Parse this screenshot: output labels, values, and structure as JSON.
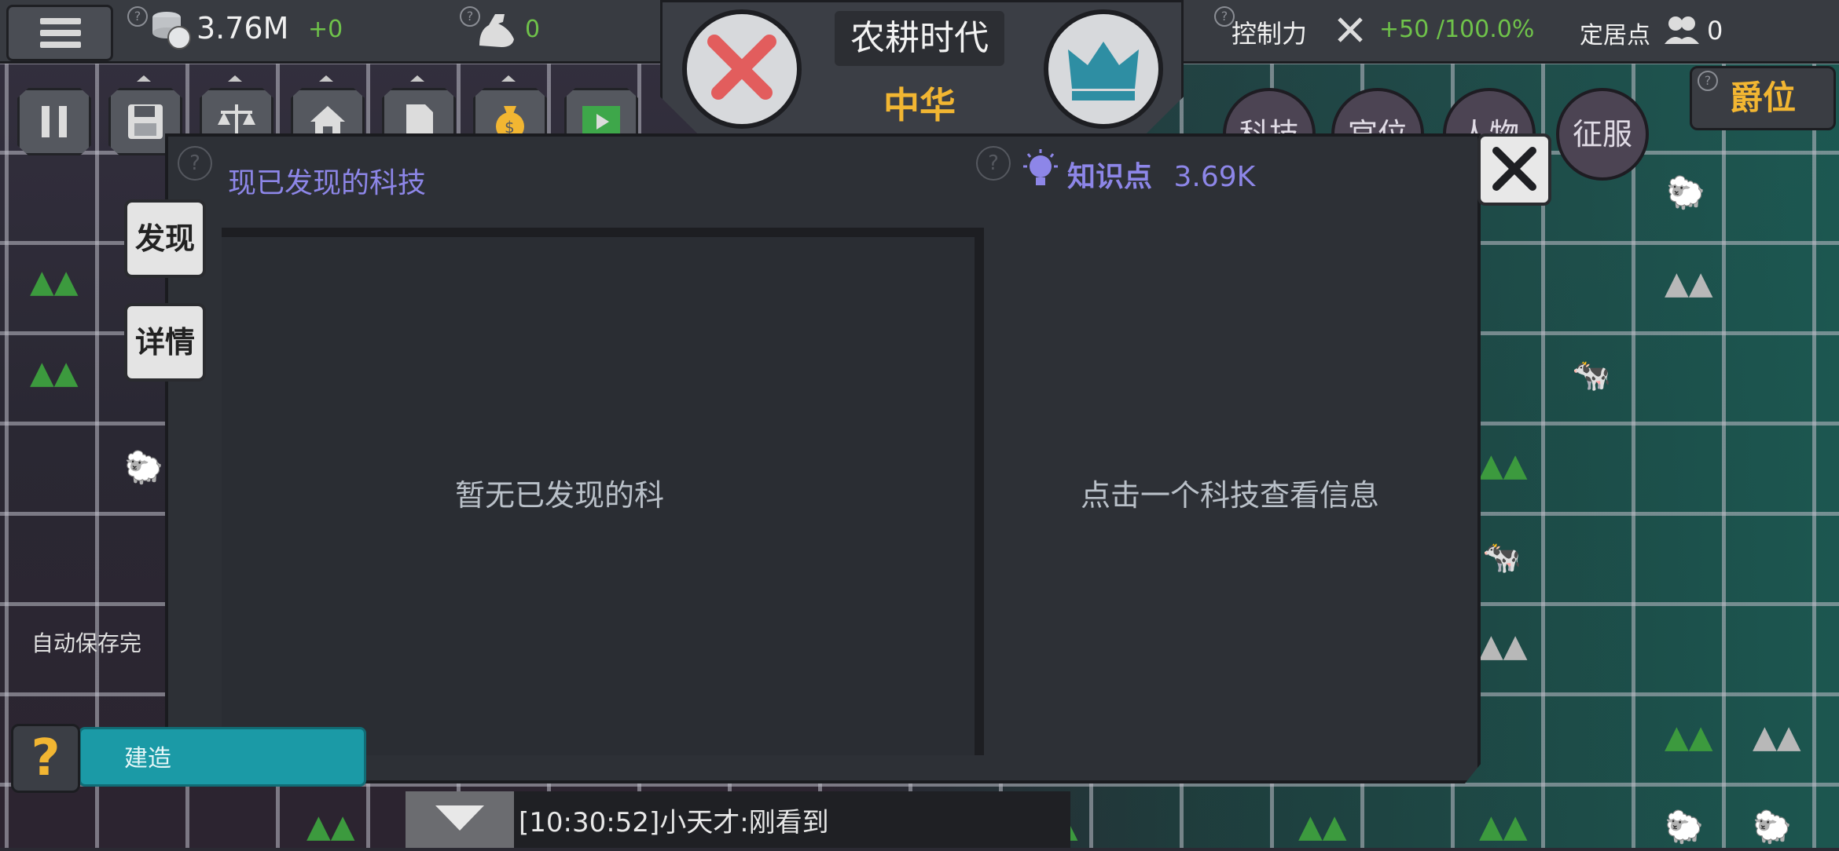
{
  "topbar": {
    "gold_value": "3.76M",
    "gold_delta": "+0",
    "strength_value": "0",
    "era_title": "农耕时代",
    "civilization": "中华",
    "control_label": "控制力",
    "control_value": "+50 /100.0%",
    "settlement_label": "定居点",
    "settlement_value": "0",
    "help_mark": "?"
  },
  "right_tabs": [
    "科技",
    "官位",
    "人物",
    "征服"
  ],
  "rank_label": "爵位",
  "panel": {
    "title": "现已发现的科技",
    "knowledge_label": "知识点",
    "knowledge_value": "3.69K",
    "empty_text": "暂无已发现的科",
    "info_text": "点击一个科技查看信息"
  },
  "side_tabs": {
    "discover": "发现",
    "details": "详情"
  },
  "bottom": {
    "autosave": "自动保存完",
    "help": "?",
    "build": "建造",
    "chat_message": "[10:30:52]小天才:刚看到"
  },
  "colors": {
    "accent_purple": "#8d86e8",
    "gold": "#f2b632",
    "positive": "#6fc24a",
    "build_teal": "#1b9aa6"
  }
}
